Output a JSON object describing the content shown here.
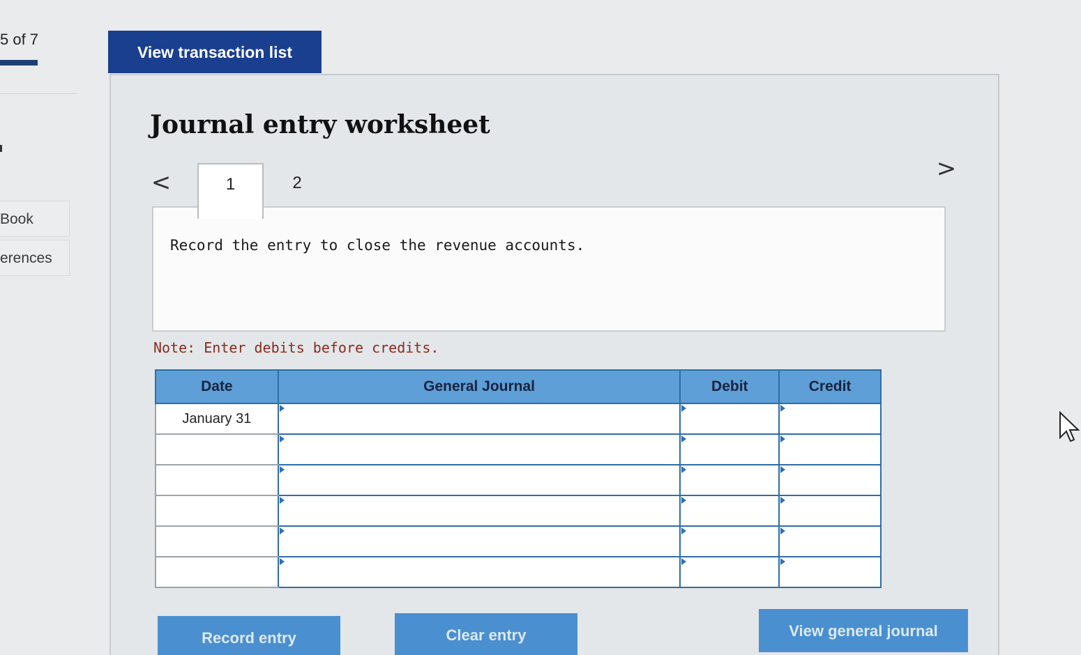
{
  "sidebar": {
    "progress_label": "5 of 7",
    "items": [
      {
        "label": "Book"
      },
      {
        "label": "erences"
      }
    ]
  },
  "header": {
    "view_transactions_label": "View transaction list"
  },
  "worksheet": {
    "title": "Journal entry worksheet",
    "tabs": [
      "1",
      "2"
    ],
    "active_tab": "1",
    "prev_arrow": "<",
    "next_arrow": ">",
    "instruction": "Record the entry to close the revenue accounts.",
    "note": "Note: Enter debits before credits."
  },
  "journal": {
    "headers": {
      "date": "Date",
      "general_journal": "General Journal",
      "debit": "Debit",
      "credit": "Credit"
    },
    "rows": [
      {
        "date": "January 31",
        "account": "",
        "debit": "",
        "credit": ""
      },
      {
        "date": "",
        "account": "",
        "debit": "",
        "credit": ""
      },
      {
        "date": "",
        "account": "",
        "debit": "",
        "credit": ""
      },
      {
        "date": "",
        "account": "",
        "debit": "",
        "credit": ""
      },
      {
        "date": "",
        "account": "",
        "debit": "",
        "credit": ""
      },
      {
        "date": "",
        "account": "",
        "debit": "",
        "credit": ""
      }
    ]
  },
  "actions": {
    "record_label": "Record entry",
    "clear_label": "Clear entry",
    "view_journal_label": "View general journal"
  },
  "colors": {
    "primary_button": "#1a3f8f",
    "table_header": "#5d9fd6",
    "table_border": "#2e6ea6",
    "note_text": "#8a2b1b",
    "action_button": "#4a8fcf"
  }
}
